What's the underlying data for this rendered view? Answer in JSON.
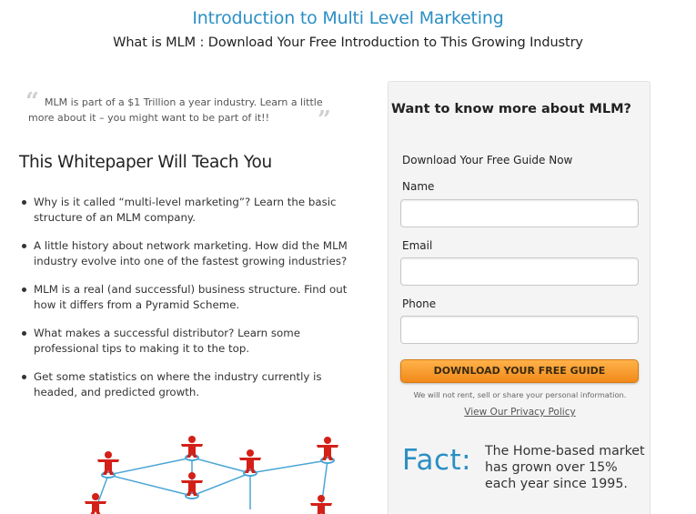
{
  "header": {
    "title": "Introduction to Multi Level Marketing",
    "subtitle": "What is MLM : Download Your Free Introduction to This Growing Industry"
  },
  "quote": {
    "open_mark": "“",
    "close_mark": "”",
    "text": "MLM is part of a $1 Trillion a year industry. Learn a little more about it – you might want to be part of it!!"
  },
  "teach": {
    "heading": "This Whitepaper Will Teach You",
    "items": [
      "Why is it called “multi-level marketing”? Learn the basic structure of an MLM company.",
      "A little history about network marketing. How did the MLM industry evolve into one of the fastest growing industries?",
      "MLM is a real (and successful) business structure. Find out how it differs from a Pyramid Scheme.",
      "What makes a successful distributor? Learn some professional tips to making it to the top.",
      "Get some statistics on where the industry currently is headed, and predicted growth."
    ]
  },
  "form": {
    "heading": "Want to know more about MLM?",
    "subheading": "Download Your Free Guide Now",
    "name_label": "Name",
    "name_value": "",
    "email_label": "Email",
    "email_value": "",
    "phone_label": "Phone",
    "phone_value": "",
    "submit_label": "DOWNLOAD YOUR FREE GUIDE",
    "privacy_note": "We will not rent, sell or share your personal information.",
    "privacy_link": "View Our Privacy Policy"
  },
  "fact": {
    "label": "Fact:",
    "text": "The Home-based market has grown over 15% each year since 1995."
  },
  "colors": {
    "accent_blue": "#2b8fc4",
    "figure_red": "#d32018",
    "node_blue": "#4aa6d6",
    "cta_orange": "#f18a1a"
  },
  "icons": {
    "quote": "quote-marks-icon",
    "network": "mlm-network-people-icon"
  }
}
